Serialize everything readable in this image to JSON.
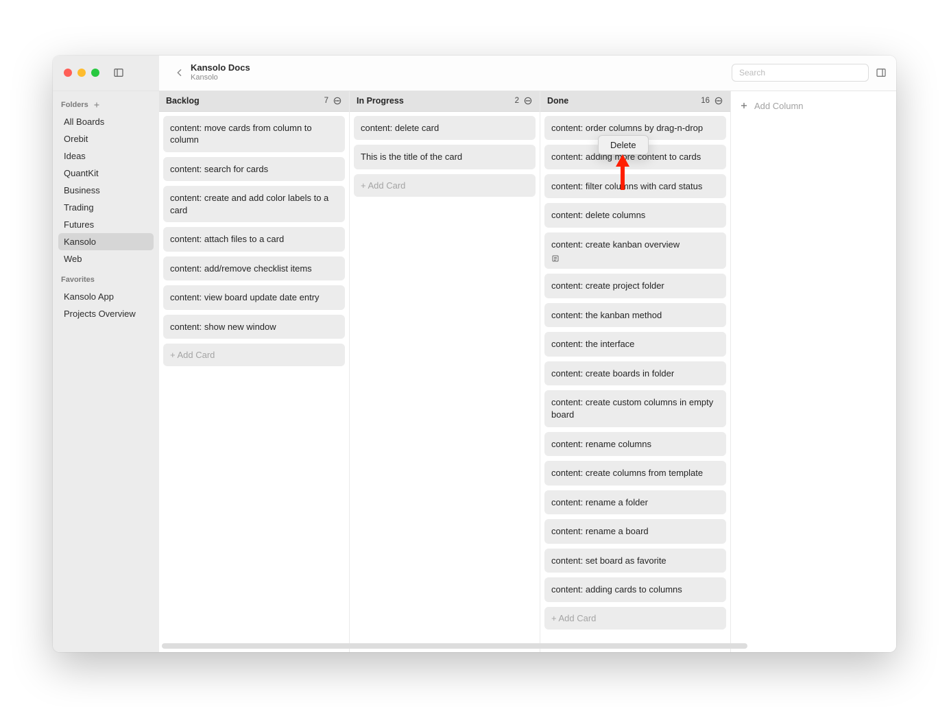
{
  "header": {
    "title": "Kansolo Docs",
    "subtitle": "Kansolo"
  },
  "search": {
    "placeholder": "Search"
  },
  "sidebar": {
    "folders_label": "Folders",
    "favorites_label": "Favorites",
    "items": [
      {
        "label": "All Boards",
        "selected": false
      },
      {
        "label": "Orebit",
        "selected": false
      },
      {
        "label": "Ideas",
        "selected": false
      },
      {
        "label": "QuantKit",
        "selected": false
      },
      {
        "label": "Business",
        "selected": false
      },
      {
        "label": "Trading",
        "selected": false
      },
      {
        "label": "Futures",
        "selected": false
      },
      {
        "label": "Kansolo",
        "selected": true
      },
      {
        "label": "Web",
        "selected": false
      }
    ],
    "favorites": [
      {
        "label": "Kansolo App"
      },
      {
        "label": "Projects Overview"
      }
    ]
  },
  "columns": [
    {
      "title": "Backlog",
      "count": "7",
      "cards": [
        {
          "title": "content: move cards from column to column"
        },
        {
          "title": "content: search for cards"
        },
        {
          "title": "content: create and add color labels to a card"
        },
        {
          "title": "content: attach files to a card"
        },
        {
          "title": "content: add/remove checklist items"
        },
        {
          "title": "content: view board update date entry"
        },
        {
          "title": "content: show new window"
        }
      ]
    },
    {
      "title": "In Progress",
      "count": "2",
      "cards": [
        {
          "title": "content: delete card"
        },
        {
          "title": "This is the title of the card"
        }
      ]
    },
    {
      "title": "Done",
      "count": "16",
      "cards": [
        {
          "title": "content: order columns by drag-n-drop"
        },
        {
          "title": "content: adding more content to cards"
        },
        {
          "title": "content: filter columns with card status"
        },
        {
          "title": "content: delete columns"
        },
        {
          "title": "content: create kanban overview",
          "has_note": true
        },
        {
          "title": "content: create project folder"
        },
        {
          "title": "content: the kanban method"
        },
        {
          "title": "content: the interface"
        },
        {
          "title": "content: create boards in folder"
        },
        {
          "title": "content: create custom columns in empty board"
        },
        {
          "title": "content: rename columns"
        },
        {
          "title": "content: create columns from template"
        },
        {
          "title": "content: rename a folder"
        },
        {
          "title": "content: rename a board"
        },
        {
          "title": "content: set board as favorite"
        },
        {
          "title": "content: adding cards to columns"
        }
      ]
    }
  ],
  "add_card_label": "+ Add Card",
  "add_column_label": "Add Column",
  "context_menu": {
    "delete_label": "Delete"
  }
}
